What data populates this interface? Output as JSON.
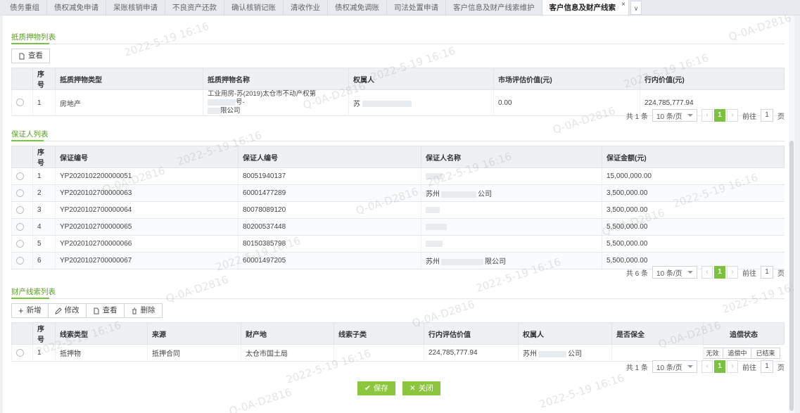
{
  "tabs": [
    {
      "label": "债务重组"
    },
    {
      "label": "债权减免申请"
    },
    {
      "label": "呆账核销申请"
    },
    {
      "label": "不良资产还款"
    },
    {
      "label": "确认核销记账"
    },
    {
      "label": "清收作业"
    },
    {
      "label": "债权减免调账"
    },
    {
      "label": "司法处置申请"
    },
    {
      "label": "客户信息及财产线索维护"
    },
    {
      "label": "客户信息及财产线索"
    }
  ],
  "tab_close": "×",
  "tab_more": "∨",
  "collateral": {
    "title": "抵质押物列表",
    "view_label": "查看",
    "columns": [
      "序号",
      "抵质押物类型",
      "抵质押物名称",
      "权属人",
      "市场评估价值(元)",
      "行内价值(元)"
    ],
    "rows": [
      {
        "no": "1",
        "type": "房地产",
        "name_l1": "工业用房-苏(2019)太仓市不动产权第",
        "name_l1b": "号-",
        "name_l2": "限公司",
        "owner": "苏",
        "market": "0.00",
        "inner": "224,785,777.94"
      }
    ],
    "pager": {
      "total": "共 1 条",
      "size": "10 条/页",
      "page": "1",
      "goto": "前往",
      "goto_val": "1",
      "unit": "页"
    }
  },
  "guarantor": {
    "title": "保证人列表",
    "columns": [
      "序号",
      "保证编号",
      "保证人编号",
      "保证人名称",
      "保证金额(元)"
    ],
    "rows": [
      {
        "no": "1",
        "code": "YP2020102200000051",
        "gid": "80051940137",
        "name": "",
        "amount": "15,000,000.00"
      },
      {
        "no": "2",
        "code": "YP2020102700000063",
        "gid": "60001477289",
        "name": "苏州",
        "name2": "公司",
        "amount": "3,500,000.00"
      },
      {
        "no": "3",
        "code": "YP2020102700000064",
        "gid": "80078089120",
        "name": "",
        "amount": "3,500,000.00"
      },
      {
        "no": "4",
        "code": "YP2020102700000065",
        "gid": "80200537448",
        "name": "",
        "amount": "5,500,000.00"
      },
      {
        "no": "5",
        "code": "YP2020102700000066",
        "gid": "80150385798",
        "name": "",
        "amount": "5,500,000.00"
      },
      {
        "no": "6",
        "code": "YP2020102700000067",
        "gid": "60001497205",
        "name": "苏州",
        "name2": "限公司",
        "amount": "5,500,000.00"
      }
    ],
    "pager": {
      "total": "共 6 条",
      "size": "10 条/页",
      "page": "1",
      "goto": "前往",
      "goto_val": "1",
      "unit": "页"
    }
  },
  "property": {
    "title": "财产线索列表",
    "toolbar": {
      "add": "新增",
      "edit": "修改",
      "view": "查看",
      "delete": "删除"
    },
    "columns": [
      "序号",
      "线索类型",
      "来源",
      "财产地",
      "线索子类",
      "行内评估价值",
      "权属人",
      "是否保全",
      "追偿状态"
    ],
    "rows": [
      {
        "no": "1",
        "type": "抵押物",
        "source": "抵押合同",
        "location": "太仓市国土局",
        "subtype": "",
        "value": "224,785,777.94",
        "owner": "苏州",
        "owner2": "公司",
        "preserved": "",
        "status": [
          "无效",
          "追偿中",
          "已结束"
        ]
      }
    ],
    "pager": {
      "total": "共 1 条",
      "size": "10 条/页",
      "page": "1",
      "goto": "前往",
      "goto_val": "1",
      "unit": "页"
    }
  },
  "footer": {
    "save": "保存",
    "close": "关闭"
  },
  "watermark": {
    "date": "2022-5-19 16:16",
    "id": "Q-0A-D2816"
  },
  "colors": {
    "accent": "#7cc142",
    "save": "#8cc63f"
  }
}
